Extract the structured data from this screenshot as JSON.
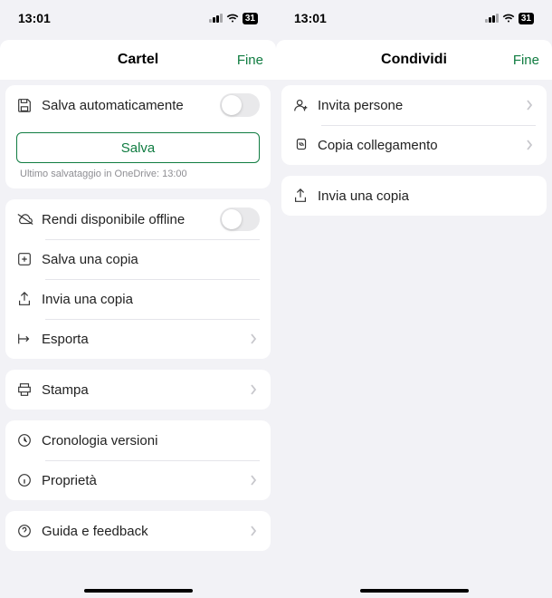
{
  "accent_color": "#107c41",
  "status": {
    "time": "13:01",
    "battery": "31"
  },
  "left": {
    "title": "Cartel",
    "done": "Fine",
    "autosave": "Salva automaticamente",
    "save_button": "Salva",
    "last_save": "Ultimo salvataggio in OneDrive: 13:00",
    "offline": "Rendi disponibile offline",
    "save_copy": "Salva una copia",
    "send_copy": "Invia una copia",
    "export": "Esporta",
    "print": "Stampa",
    "history": "Cronologia versioni",
    "properties": "Proprietà",
    "help": "Guida e feedback"
  },
  "right": {
    "title": "Condividi",
    "done": "Fine",
    "invite": "Invita persone",
    "copy_link": "Copia collegamento",
    "send_copy": "Invia una copia"
  }
}
